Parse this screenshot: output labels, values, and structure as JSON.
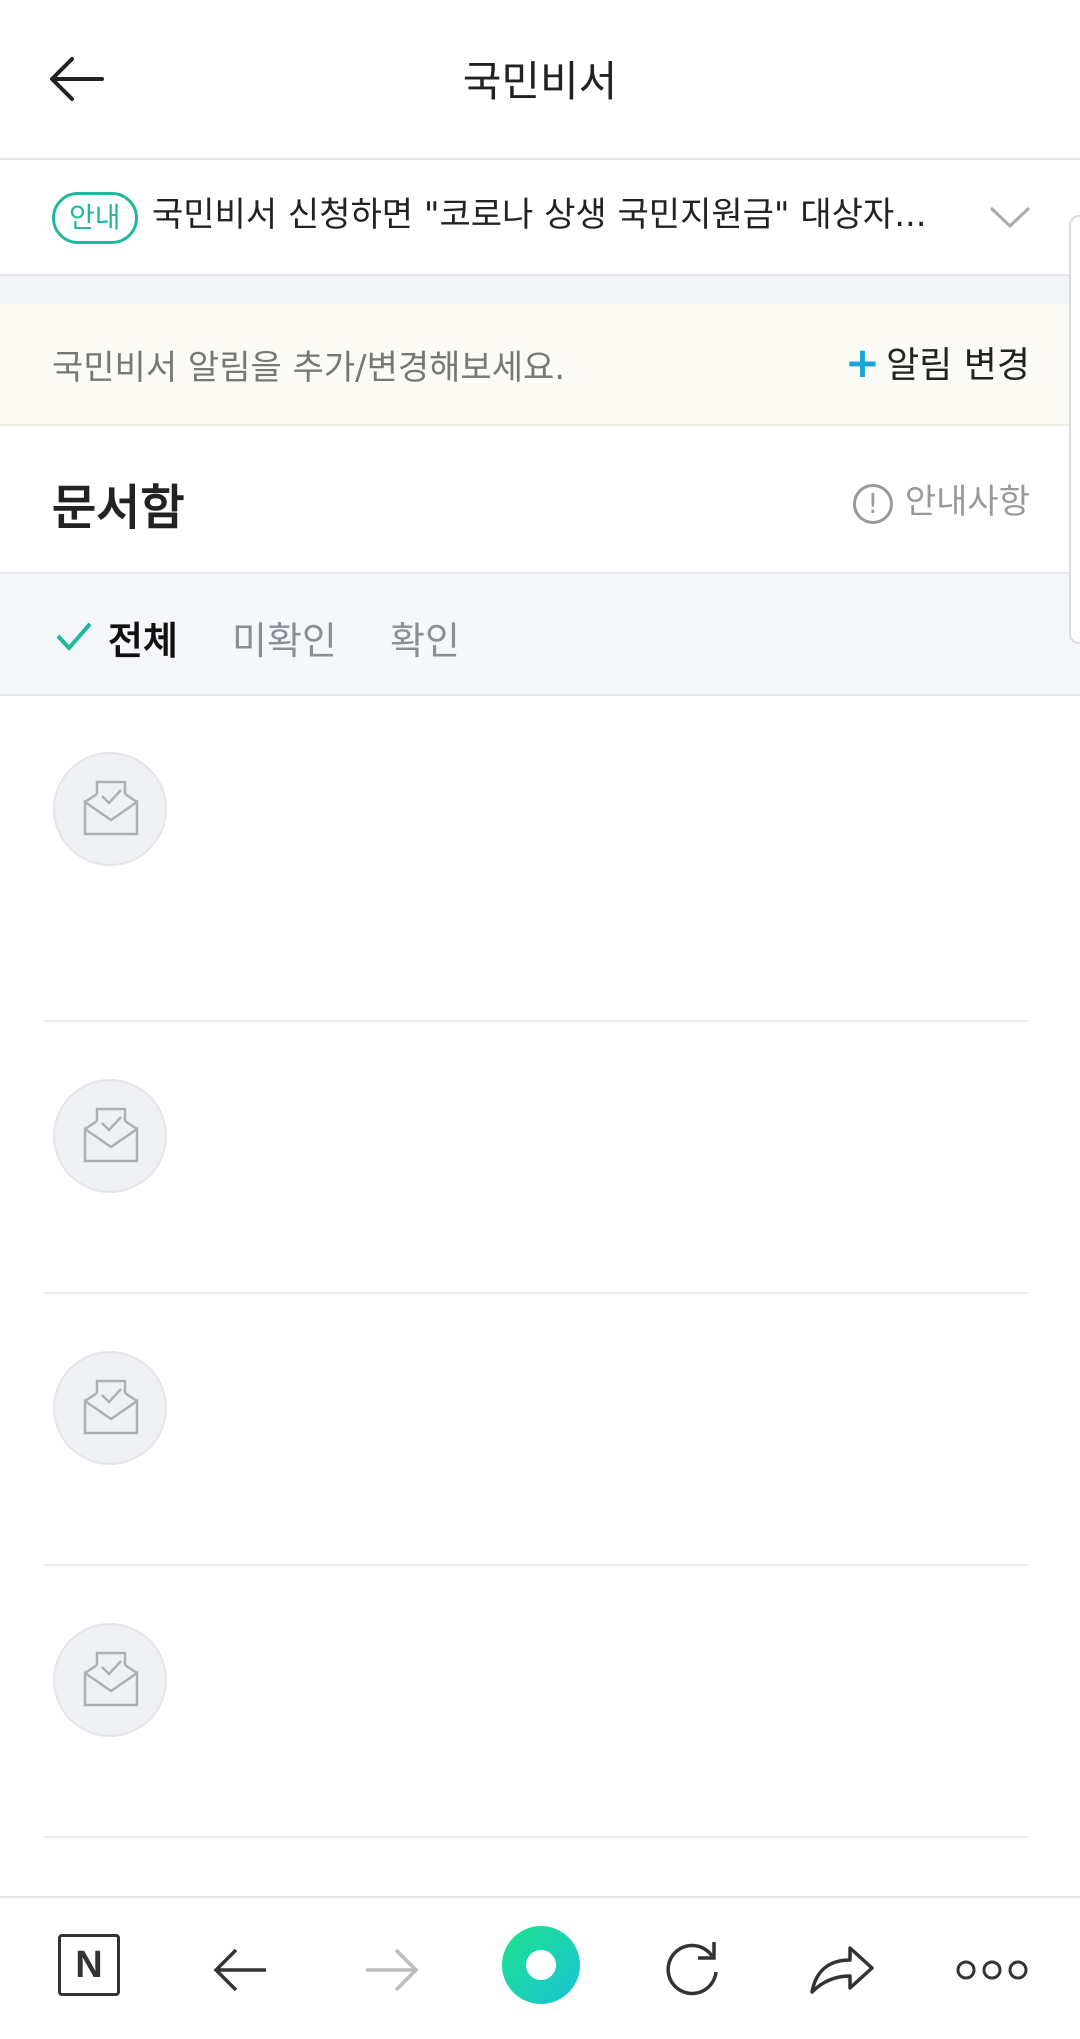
{
  "header": {
    "title": "국민비서",
    "back_icon": "arrow-left-icon"
  },
  "notice": {
    "badge": "안내",
    "text": "국민비서 신청하면 \"코로나 상생 국민지원금\" 대상자...",
    "accent_color": "#1fb89c"
  },
  "alarm": {
    "message": "국민비서 알림을 추가/변경해보세요.",
    "change_plus": "+",
    "change_label": "알림 변경"
  },
  "docbox": {
    "title": "문서함",
    "guide_icon": "!",
    "guide_label": "안내사항"
  },
  "filters": [
    {
      "label": "전체",
      "active": true
    },
    {
      "label": "미확인",
      "active": false
    },
    {
      "label": "확인",
      "active": false
    }
  ],
  "bottom_bar": {
    "n_label": "N",
    "buttons": [
      "naver-icon",
      "back-icon",
      "forward-icon",
      "home-icon",
      "refresh-icon",
      "share-icon",
      "more-icon"
    ]
  }
}
